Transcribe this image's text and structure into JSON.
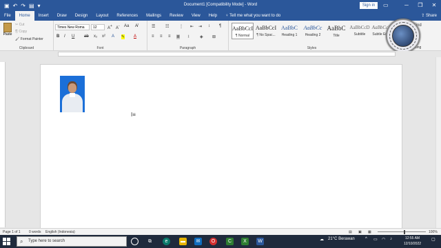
{
  "window": {
    "title": "Document1 [Compatibility Mode] - Word",
    "sign_in": "Sign in",
    "qat": [
      "Save",
      "Undo",
      "Redo",
      "Customize"
    ]
  },
  "tabs": [
    "File",
    "Home",
    "Insert",
    "Draw",
    "Design",
    "Layout",
    "References",
    "Mailings",
    "Review",
    "View",
    "Help"
  ],
  "active_tab": "Home",
  "tell_me": "Tell me what you want to do",
  "share": "Share",
  "clipboard": {
    "paste": "Paste",
    "cut": "Cut",
    "copy": "Copy",
    "format_painter": "Format Painter",
    "label": "Clipboard"
  },
  "font": {
    "name": "Times New Roma",
    "size": "12",
    "label": "Font"
  },
  "paragraph": {
    "label": "Paragraph"
  },
  "styles": {
    "label": "Styles",
    "items": [
      {
        "preview": "AaBbCcI",
        "name": "¶ Normal"
      },
      {
        "preview": "AaBbCcI",
        "name": "¶ No Spac..."
      },
      {
        "preview": "AaBbC",
        "name": "Heading 1"
      },
      {
        "preview": "AaBbCc",
        "name": "Heading 2"
      },
      {
        "preview": "AaBbC",
        "name": "Title"
      },
      {
        "preview": "AaBbCcD",
        "name": "Subtitle"
      },
      {
        "preview": "AaBbCcD",
        "name": "Subtle Em..."
      }
    ]
  },
  "editing": {
    "find": "Find",
    "editing": "Editing"
  },
  "status": {
    "page": "Page 1 of 1",
    "words": "0 words",
    "language": "English (Indonesia)",
    "zoom": "100%"
  },
  "taskbar": {
    "search_placeholder": "Type here to search",
    "weather": "21°C  Berawan",
    "time": "12:55 AM",
    "date": "12/10/2022"
  },
  "colors": {
    "word_blue": "#2b579a",
    "taskbar": "#1f2a3c"
  }
}
